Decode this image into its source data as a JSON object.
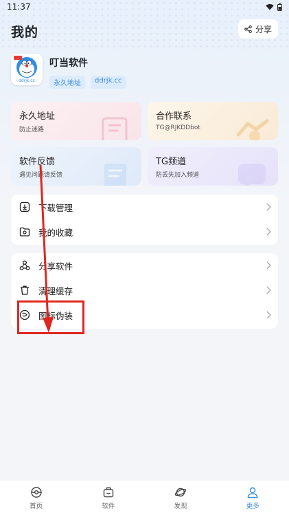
{
  "status_bar": {
    "time": "11:37"
  },
  "header": {
    "title": "我的",
    "share_label": "分享"
  },
  "profile": {
    "app_name": "叮当软件",
    "logo_text": "ddrjk.cc",
    "tags": [
      "永久地址",
      "ddrjk.cc"
    ]
  },
  "quick_cards": [
    {
      "title": "永久地址",
      "subtitle": "防止迷路",
      "bg": "#fbeaee"
    },
    {
      "title": "合作联系",
      "subtitle": "TG@RJKDDbot",
      "bg": "#fbf1e2"
    },
    {
      "title": "软件反馈",
      "subtitle": "遇见问题请反馈",
      "bg": "#e6f0fb"
    },
    {
      "title": "TG频道",
      "subtitle": "防丢失加入频道",
      "bg": "#ece9fb"
    }
  ],
  "list_group_1": [
    {
      "label": "下载管理",
      "icon": "download-icon"
    },
    {
      "label": "我的收藏",
      "icon": "favorites-folder-icon"
    }
  ],
  "list_group_2": [
    {
      "label": "分享软件",
      "icon": "share-nodes-icon"
    },
    {
      "label": "清理缓存",
      "icon": "trash-icon"
    },
    {
      "label": "图标伪装",
      "icon": "disguise-icon"
    }
  ],
  "tabbar": [
    {
      "label": "首页",
      "icon": "home-icon"
    },
    {
      "label": "软件",
      "icon": "software-bag-icon"
    },
    {
      "label": "发现",
      "icon": "planet-icon"
    },
    {
      "label": "更多",
      "icon": "user-icon"
    }
  ],
  "colors": {
    "accent": "#3d8ee0",
    "annotation": "#e0271f"
  }
}
